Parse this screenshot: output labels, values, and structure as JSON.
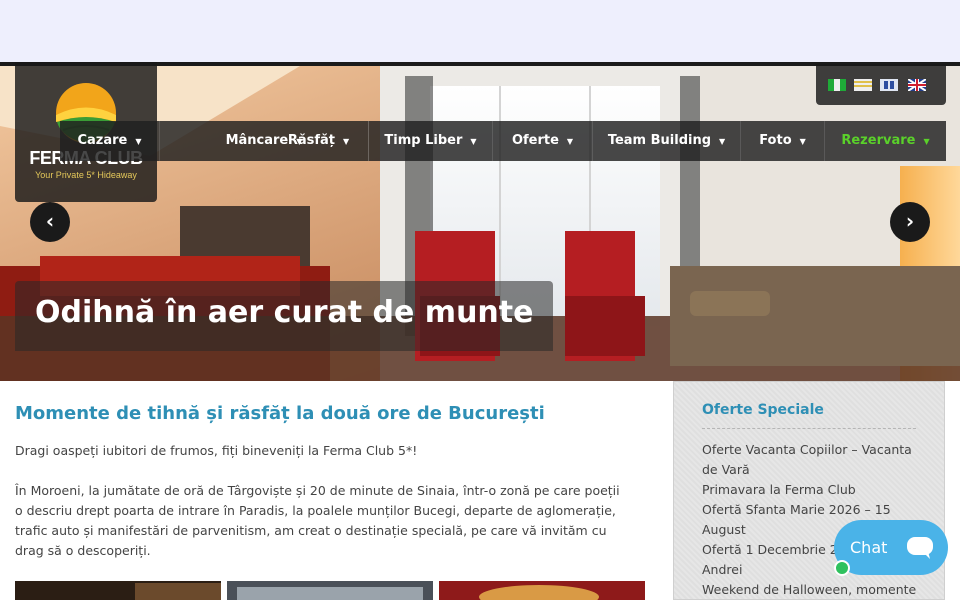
{
  "brand": {
    "name": "FERMA CLUB",
    "tagline": "Your Private 5* Hideaway"
  },
  "languages": [
    "ro-flag-icon",
    "gr-flag-icon",
    "ru-flag-icon",
    "uk-flag-icon"
  ],
  "nav": {
    "items": [
      {
        "label": "Cazare"
      },
      {
        "label": "Mâncare"
      },
      {
        "label": "Răsfăț"
      },
      {
        "label": "Timp Liber"
      },
      {
        "label": "Oferte"
      },
      {
        "label": "Team Building"
      },
      {
        "label": "Foto"
      },
      {
        "label": "Rezervare"
      }
    ],
    "accent_color": "#5ad12a"
  },
  "slider": {
    "caption": "Odihnă în aer curat de munte",
    "prev_icon": "chevron-left-icon",
    "next_icon": "chevron-right-icon"
  },
  "main": {
    "title": "Momente de tihnă și răsfăț la două ore de București",
    "intro": "Dragi oaspeți iubitori de frumos, fiți bineveniți la Ferma Club 5*!",
    "body": "În Moroeni, la jumătate de oră de Târgoviște și 20 de minute de Sinaia, într-o zonă pe care poeții o descriu drept poarta de intrare în Paradis, la poalele munților Bucegi, departe de aglomerație, trafic auto și manifestări de parvenitism, am creat o destinație specială, pe care vă invităm cu drag să o descoperiți."
  },
  "sidebar": {
    "title": "Oferte Speciale",
    "items": [
      "Oferte Vacanta Copiilor – Vacanta de Vară",
      "Primavara la Ferma Club",
      "Ofertă Sfanta Marie 2026 – 15 August",
      "Ofertă 1 Decembrie 2026 + Sf Andrei",
      "Weekend de Halloween, momente"
    ]
  },
  "chat": {
    "label": "Chat"
  },
  "colors": {
    "title_blue": "#2e8fb5",
    "chat_blue": "#4ab3e8",
    "online_green": "#2fc15e"
  }
}
